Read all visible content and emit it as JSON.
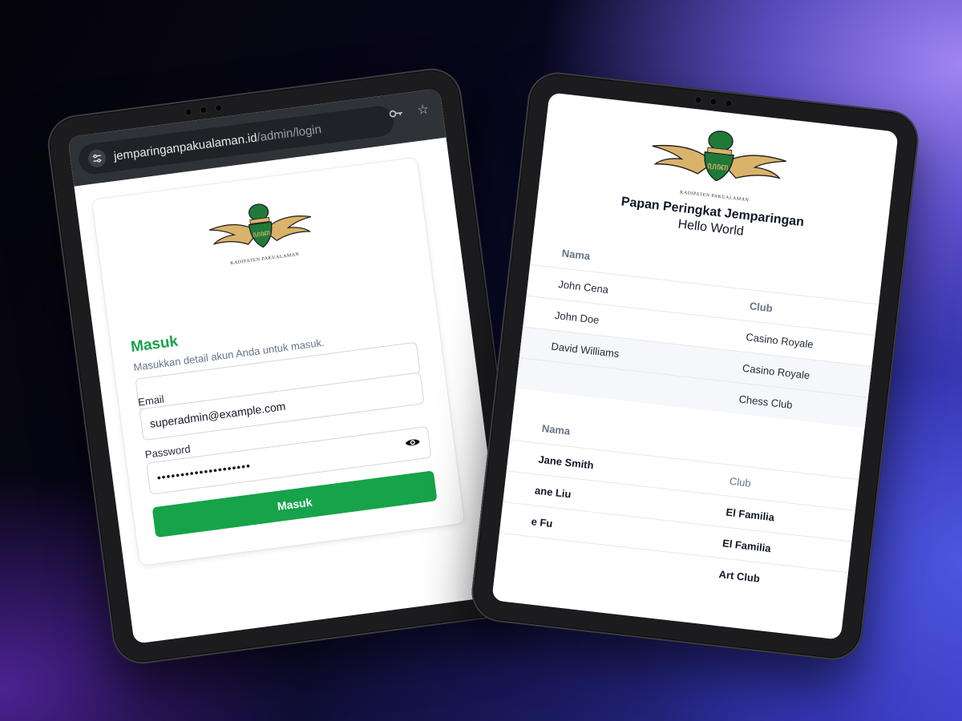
{
  "browser": {
    "url_domain": "jemparinganpakualaman.id",
    "url_path": "/admin/login"
  },
  "logo": {
    "caption": "KADIPATEN PAKUALAMAN"
  },
  "login": {
    "title": "Masuk",
    "subtitle": "Masukkan detail akun Anda untuk masuk.",
    "email_label": "Email",
    "email_value": "superadmin@example.com",
    "password_label": "Password",
    "password_value": "••••••••••••••••••••",
    "submit_label": "Masuk"
  },
  "leaderboard": {
    "title": "Papan Peringkat Jemparingan",
    "subtitle": "Hello World",
    "table1": {
      "col_name": "Nama",
      "col_club": "Club",
      "rows": [
        {
          "name": "John Cena",
          "club": ""
        },
        {
          "name": "John Doe",
          "club": "Casino Royale"
        },
        {
          "name": "David Williams",
          "club": "Casino Royale"
        },
        {
          "name": "",
          "club": "Chess Club"
        }
      ]
    },
    "table2": {
      "col_name": "Nama",
      "col_club": "Club",
      "rows": [
        {
          "name": "Jane Smith",
          "club": ""
        },
        {
          "name": "ane Liu",
          "club": "El Familia"
        },
        {
          "name": "e Fu",
          "club": "El Familia"
        },
        {
          "name": "",
          "club": "Art Club"
        }
      ]
    }
  },
  "colors": {
    "accent_green": "#16a34a",
    "logo_green": "#1f7a3a",
    "logo_gold": "#d9b36a"
  }
}
